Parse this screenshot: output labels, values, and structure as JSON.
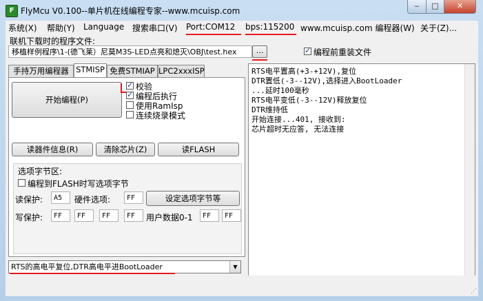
{
  "window": {
    "title": "FlyMcu V0.100--单片机在线编程专家--www.mcuisp.com",
    "icon_glyph": "F",
    "min_glyph": "‒",
    "max_glyph": "□",
    "close_glyph": "✕"
  },
  "menu": {
    "items": [
      "系统(X)",
      "帮助(Y)",
      "Language",
      "搜索串口(V)",
      "Port:COM12",
      "bps:115200",
      "www.mcuisp.com 编程器(W)",
      "关于(Z)..."
    ]
  },
  "file": {
    "label": "联机下载时的程序文件:",
    "path": "移植样例程序\\1-(德飞莱）尼莫M3S-LED点亮和熄灭\\OBJ\\test.hex",
    "browse_label": "...",
    "reload_label": "编程前重装文件",
    "reload_checked": true
  },
  "tabs": [
    "手持万用编程器",
    "STMISP",
    "免费STMIAP",
    "LPC2xxxISP"
  ],
  "stmisp": {
    "start_button": "开始编程(P)",
    "options": [
      {
        "label": "校验",
        "checked": true
      },
      {
        "label": "编程后执行",
        "checked": true
      },
      {
        "label": "使用RamIsp",
        "checked": false
      },
      {
        "label": "连续烧录模式",
        "checked": false
      }
    ],
    "read_info_button": "读器件信息(R)",
    "erase_button": "清除芯片(Z)",
    "read_flash_button": "读FLASH",
    "option_bytes": {
      "group_label": "选项字节区:",
      "write_on_program_label": "编程到FLASH时写选项字节",
      "write_on_program_checked": false,
      "read_protect_label": "读保护:",
      "read_protect_value": "A5",
      "hw_option_label": "硬件选项:",
      "hw_option_value": "FF",
      "set_button": "设定选项字节等",
      "write_protect_label": "写保护:",
      "write_protect_values": [
        "FF",
        "FF",
        "FF",
        "FF"
      ],
      "user_data_label": "用户数据0-1",
      "user_data_values": [
        "FF",
        "FF"
      ]
    }
  },
  "log": {
    "lines": [
      "RTS电平置高(+3-+12V),复位",
      "DTR置低(-3--12V),选择进入BootLoader",
      "...延时100毫秒",
      "RTS电平变低(-3--12V)释放复位",
      "DTR维持低",
      "开始连接...401, 接收到:",
      "芯片超时无应答, 无法连接"
    ]
  },
  "boot_mode": {
    "selected": "RTS的高电平复位,DTR高电平进BootLoader",
    "arrow_glyph": "▼"
  },
  "status": {
    "grip_glyph": "⋰"
  },
  "colors": {
    "annotation_red": "#e8191e",
    "close_red": "#c5432b"
  }
}
